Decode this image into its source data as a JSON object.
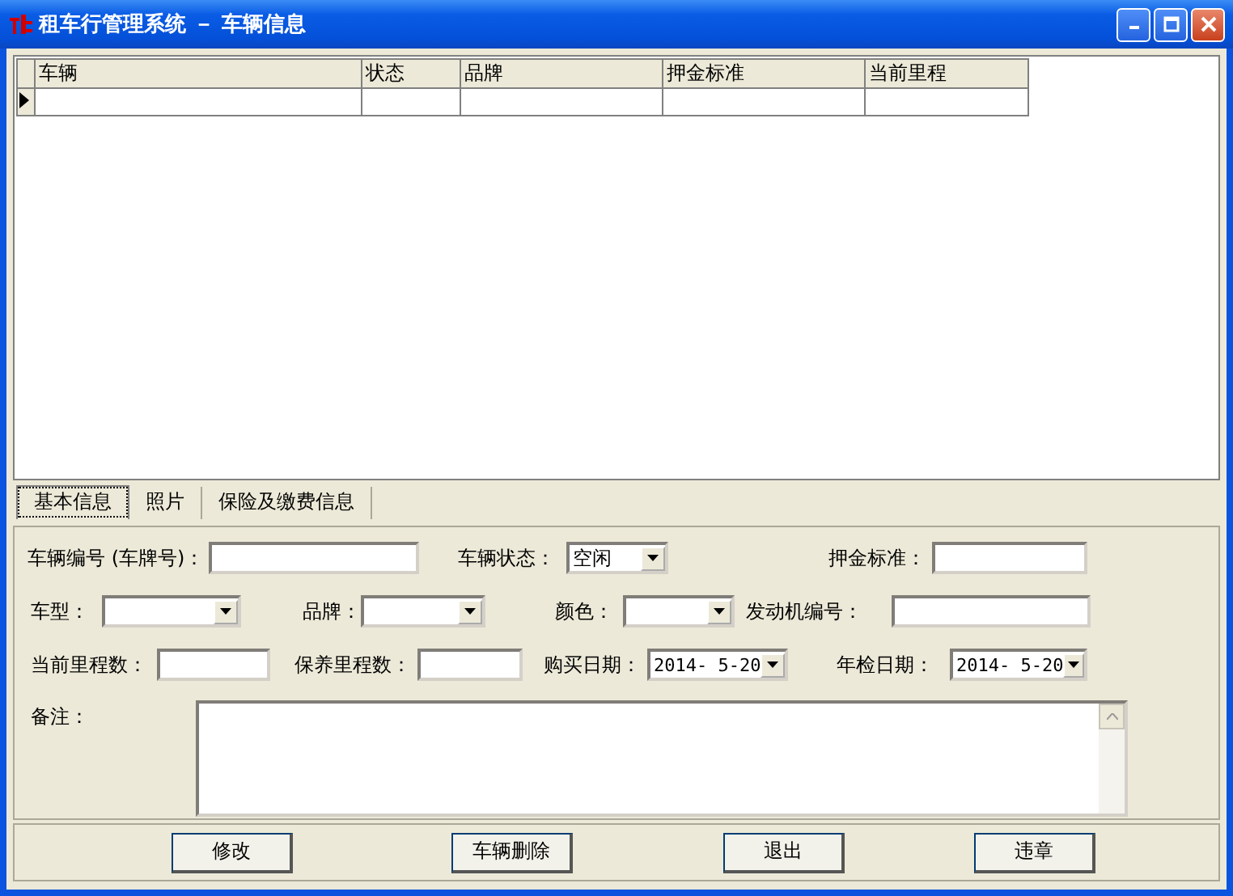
{
  "window": {
    "title": "租车行管理系统 － 车辆信息"
  },
  "table": {
    "columns": [
      "车辆",
      "状态",
      "品牌",
      "押金标准",
      "当前里程"
    ],
    "rows": [
      {
        "current": true
      }
    ]
  },
  "tabs": [
    {
      "label": "基本信息",
      "selected": true
    },
    {
      "label": "照片",
      "selected": false
    },
    {
      "label": "保险及缴费信息",
      "selected": false
    }
  ],
  "form": {
    "rows": [
      [
        {
          "label": "车辆编号 (车牌号)：",
          "kind": "text"
        },
        {
          "label": "车辆状态：",
          "kind": "combo",
          "value": "空闲"
        },
        {
          "label": "押金标准：",
          "kind": "text"
        }
      ],
      [
        {
          "label": "车型：",
          "kind": "combo"
        },
        {
          "label": "品牌：",
          "kind": "combo"
        },
        {
          "label": "颜色：",
          "kind": "combo"
        },
        {
          "label": "发动机编号：",
          "kind": "text"
        }
      ],
      [
        {
          "label": "当前里程数：",
          "kind": "text"
        },
        {
          "label": "保养里程数：",
          "kind": "text"
        },
        {
          "label": "购买日期：",
          "kind": "date",
          "value": "2014- 5-20"
        },
        {
          "label": "年检日期：",
          "kind": "date",
          "value": "2014- 5-20"
        }
      ]
    ],
    "remark": {
      "label": "备注："
    }
  },
  "buttons": [
    "修改",
    "车辆删除",
    "退出",
    "违章"
  ]
}
